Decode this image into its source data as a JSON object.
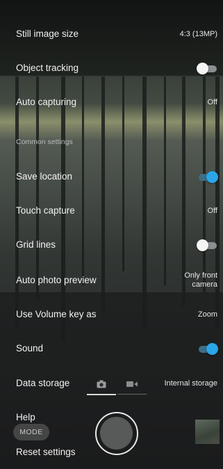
{
  "settings": {
    "still_image_size": {
      "label": "Still image size",
      "value": "4:3 (13MP)"
    },
    "object_tracking": {
      "label": "Object tracking",
      "state": "off"
    },
    "auto_capturing": {
      "label": "Auto capturing",
      "value": "Off"
    },
    "common_settings_header": "Common settings",
    "save_location": {
      "label": "Save location",
      "state": "on"
    },
    "touch_capture": {
      "label": "Touch capture",
      "value": "Off"
    },
    "grid_lines": {
      "label": "Grid lines",
      "state": "off"
    },
    "auto_photo_preview": {
      "label": "Auto photo preview",
      "value_line1": "Only front",
      "value_line2": "camera"
    },
    "volume_key": {
      "label": "Use Volume key as",
      "value": "Zoom"
    },
    "sound": {
      "label": "Sound",
      "state": "on"
    },
    "data_storage": {
      "label": "Data storage",
      "value": "Internal storage",
      "icons": [
        "camera-icon",
        "video-icon"
      ]
    },
    "help": {
      "label": "Help"
    },
    "reset_settings": {
      "label": "Reset settings"
    }
  },
  "camera_controls": {
    "mode_button": "MODE"
  },
  "colors": {
    "toggle_on": "#2aa6e8",
    "toggle_off_knob": "#f5f5f5"
  }
}
